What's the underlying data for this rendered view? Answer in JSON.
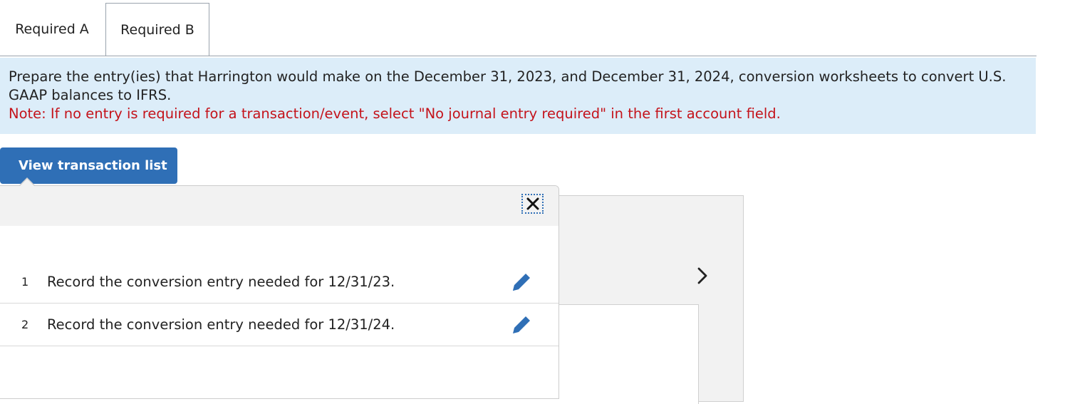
{
  "tabs": [
    {
      "label": "Required A"
    },
    {
      "label": "Required B"
    }
  ],
  "instructions": {
    "text": "Prepare the entry(ies) that Harrington would make on the December 31, 2023, and December 31, 2024, conversion worksheets to convert U.S. GAAP balances to IFRS.",
    "note": "Note: If no entry is required for a transaction/event, select \"No journal entry required\" in the first account field."
  },
  "view_button": {
    "label": "View transaction list"
  },
  "transactions": [
    {
      "number": "1",
      "text": "Record the conversion entry needed for 12/31/23.",
      "icon": "pencil-icon"
    },
    {
      "number": "2",
      "text": "Record the conversion entry needed for 12/31/24.",
      "icon": "pencil-icon"
    }
  ],
  "icons": {
    "close": "close-icon",
    "next": "chevron-right-icon"
  },
  "colors": {
    "accent": "#2f6fb6",
    "info_bg": "#dcedf9",
    "note": "#c4131b"
  }
}
